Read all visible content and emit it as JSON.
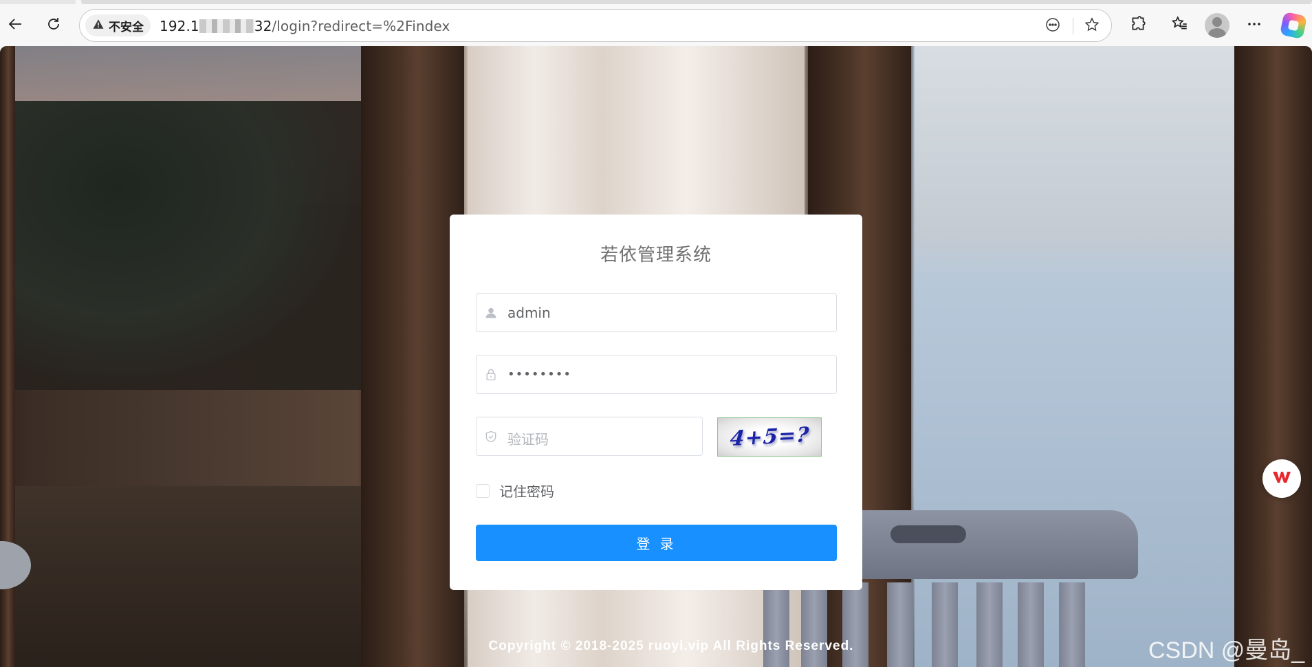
{
  "browser": {
    "security_label": "不安全",
    "url_host_prefix": "192.1",
    "url_host_suffix": "32",
    "url_path": "/login?redirect=%2Findex",
    "icons": {
      "back": "back-arrow-icon",
      "reload": "reload-icon",
      "warning": "warning-triangle-icon",
      "read_aloud": "more-circle-icon",
      "favorite": "star-icon",
      "extensions": "puzzle-icon",
      "favorites_list": "favorites-icon",
      "profile": "avatar-icon",
      "menu": "ellipsis-icon",
      "copilot": "copilot-icon"
    }
  },
  "login": {
    "title": "若依管理系统",
    "username_value": "admin",
    "password_value": "••••••••",
    "captcha_placeholder": "验证码",
    "captcha_text": "4+5=?",
    "remember_label": "记住密码",
    "remember_checked": false,
    "submit_label": "登 录",
    "accent_color": "#1890ff"
  },
  "footer": {
    "copyright": "Copyright © 2018-2025 ruoyi.vip All Rights Reserved.",
    "watermark": "CSDN @曼岛_"
  },
  "floating": {
    "wps_icon": "wps-icon"
  }
}
